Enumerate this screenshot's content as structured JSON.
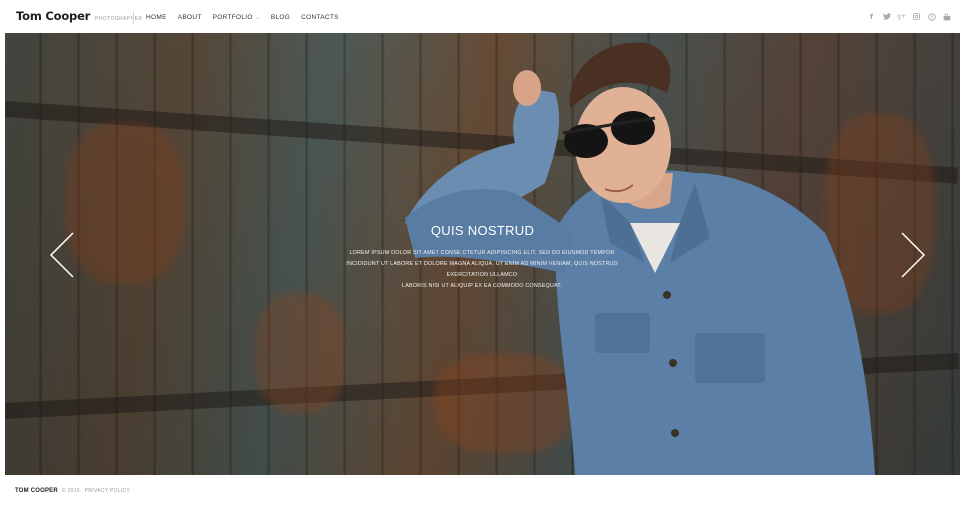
{
  "header": {
    "brand_name": "Tom Cooper",
    "brand_tagline": "PHOTOGRAPHER",
    "nav": [
      {
        "label": "HOME",
        "has_dropdown": false
      },
      {
        "label": "ABOUT",
        "has_dropdown": false
      },
      {
        "label": "PORTFOLIO",
        "has_dropdown": true
      },
      {
        "label": "BLOG",
        "has_dropdown": false
      },
      {
        "label": "CONTACTS",
        "has_dropdown": false
      }
    ],
    "social_icons": [
      "facebook-icon",
      "twitter-icon",
      "google-plus-icon",
      "instagram-icon",
      "skype-icon",
      "youtube-icon"
    ]
  },
  "hero": {
    "title": "QUIS NOSTRUD",
    "text_lines": [
      "LOREM IPSUM DOLOR SIT AMET CONSE CTETUR ADIPISICING ELIT, SED DO EIUSMOD TEMPOR",
      "INCIDIDUNT UT LABORE ET DOLORE MAGNA ALIQUA. UT ENIM AD MINIM VENIAM, QUIS NOSTRUD EXERCITATION ULLAMCO",
      "LABORIS NISI UT ALIQUIP EX EA COMMODO CONSEQUAT."
    ],
    "prev_icon": "chevron-left-icon",
    "next_icon": "chevron-right-icon"
  },
  "footer": {
    "brand": "TOM COOPER",
    "copyright": "© 2015.",
    "privacy_link": "PRIVACY POLICY"
  },
  "colors": {
    "text_dark": "#1e1e1e",
    "muted": "#9a9a9a",
    "social": "#a9a9a9",
    "denim": "#5b7fa6"
  }
}
